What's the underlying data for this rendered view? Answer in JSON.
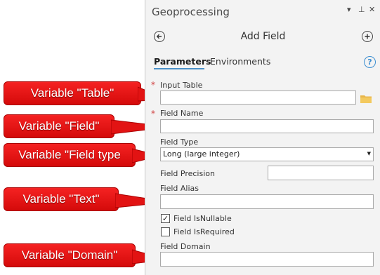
{
  "header": {
    "title": "Geoprocessing",
    "ctrl_dropdown": "▾",
    "ctrl_pin": "⊥",
    "ctrl_close": "✕"
  },
  "tool": {
    "title": "Add Field",
    "back_icon": "back-arrow-icon",
    "add_icon": "plus-icon"
  },
  "tabs": [
    {
      "label": "Parameters",
      "active": true
    },
    {
      "label": "Environments",
      "active": false
    }
  ],
  "help_label": "?",
  "params": {
    "input_table": {
      "label": "Input Table",
      "required": "*",
      "value": ""
    },
    "field_name": {
      "label": "Field Name",
      "required": "*",
      "value": ""
    },
    "field_type": {
      "label": "Field Type",
      "value": "Long (large integer)"
    },
    "field_precision": {
      "label": "Field Precision",
      "value": ""
    },
    "field_alias": {
      "label": "Field Alias",
      "value": ""
    },
    "field_isnullable": {
      "label": "Field IsNullable",
      "checked": true,
      "mark": "✓"
    },
    "field_isrequired": {
      "label": "Field IsRequired",
      "checked": false,
      "mark": ""
    },
    "field_domain": {
      "label": "Field Domain",
      "value": ""
    }
  },
  "callouts": [
    "Variable \"Table\"",
    "Variable \"Field\"",
    "Variable \"Field type",
    "Variable \"Text\"",
    "Variable \"Domain\""
  ],
  "colors": {
    "callout": "#e21313",
    "accent": "#3d8fd1",
    "required": "#d04040",
    "folder": "#e8b64a"
  }
}
